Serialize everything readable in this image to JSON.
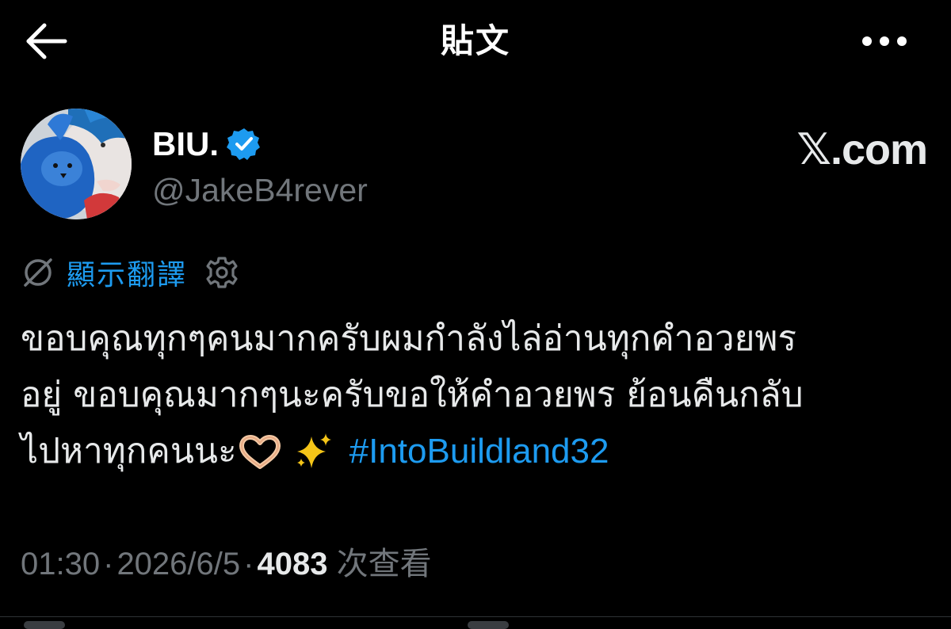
{
  "header": {
    "title": "貼文"
  },
  "author": {
    "display_name": "BIU.",
    "handle": "@JakeB4rever",
    "verified": true,
    "verified_color": "#1d9bf0"
  },
  "watermark": {
    "text": "𝕏.com"
  },
  "translate": {
    "label": "顯示翻譯"
  },
  "tweet": {
    "lines": [
      "ขอบคุณทุกๆคนมากครับผมกำลังไล่อ่านทุกคำอวยพร",
      "อยู่ ขอบคุณมากๆนะครับขอให้คำอวยพร ย้อนคืนกลับ",
      "ไปหาทุกคนนะ"
    ],
    "emojis": [
      "🫶🏻",
      "✨"
    ],
    "hashtag": "#IntoBuildland32"
  },
  "meta": {
    "time": "01:30",
    "separator": "·",
    "date": "2026/6/5",
    "views_count": "4083",
    "views_label": "次查看"
  },
  "colors": {
    "background": "#000000",
    "text": "#e7e9ea",
    "muted": "#71767b",
    "accent": "#1d9bf0"
  },
  "icons": {
    "back": "arrow-left-icon",
    "more": "more-horizontal-icon",
    "translate": "globe-slash-icon",
    "settings": "gear-icon"
  }
}
